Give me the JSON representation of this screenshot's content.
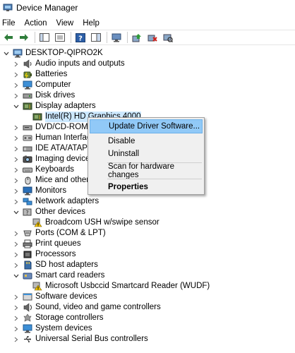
{
  "window": {
    "title": "Device Manager"
  },
  "menu": {
    "items": [
      "File",
      "Action",
      "View",
      "Help"
    ]
  },
  "toolbar": {
    "buttons": [
      "back-arrow-icon",
      "forward-arrow-icon",
      "show-hide-console-tree-icon",
      "properties-icon",
      "help-icon",
      "action-pane-icon",
      "device-monitor-icon",
      "update-driver-icon",
      "uninstall-icon",
      "scan-hardware-icon"
    ]
  },
  "tree": {
    "root": "DESKTOP-QIPRO2K",
    "categories": [
      {
        "label": "Audio inputs and outputs",
        "icon": "speaker-icon"
      },
      {
        "label": "Batteries",
        "icon": "battery-icon"
      },
      {
        "label": "Computer",
        "icon": "computer-icon"
      },
      {
        "label": "Disk drives",
        "icon": "disk-drive-icon"
      },
      {
        "label": "Display adapters",
        "icon": "display-adapter-icon",
        "expanded": true,
        "children": [
          {
            "label": "Intel(R) HD Graphics 4000",
            "selected": true
          }
        ]
      },
      {
        "label": "DVD/CD-ROM dr",
        "icon": "dvd-icon"
      },
      {
        "label": "Human Interface",
        "icon": "hid-icon"
      },
      {
        "label": "IDE ATA/ATAPI co",
        "icon": "ide-icon"
      },
      {
        "label": "Imaging devices",
        "icon": "camera-icon"
      },
      {
        "label": "Keyboards",
        "icon": "keyboard-icon"
      },
      {
        "label": "Mice and other p",
        "icon": "mouse-icon"
      },
      {
        "label": "Monitors",
        "icon": "monitor-icon"
      },
      {
        "label": "Network adapters",
        "icon": "network-icon"
      },
      {
        "label": "Other devices",
        "icon": "other-devices-icon",
        "expanded": true,
        "children": [
          {
            "label": "Broadcom USH w/swipe sensor",
            "warning": true
          }
        ]
      },
      {
        "label": "Ports (COM & LPT)",
        "icon": "port-icon"
      },
      {
        "label": "Print queues",
        "icon": "printer-icon"
      },
      {
        "label": "Processors",
        "icon": "processor-icon"
      },
      {
        "label": "SD host adapters",
        "icon": "sd-icon"
      },
      {
        "label": "Smart card readers",
        "icon": "smart-card-icon",
        "expanded": true,
        "children": [
          {
            "label": "Microsoft Usbccid Smartcard Reader (WUDF)",
            "warning": true
          }
        ]
      },
      {
        "label": "Software devices",
        "icon": "software-icon"
      },
      {
        "label": "Sound, video and game controllers",
        "icon": "sound-icon"
      },
      {
        "label": "Storage controllers",
        "icon": "storage-icon"
      },
      {
        "label": "System devices",
        "icon": "system-icon"
      },
      {
        "label": "Universal Serial Bus controllers",
        "icon": "usb-icon"
      }
    ]
  },
  "context_menu": {
    "items": [
      "Update Driver Software...",
      "Disable",
      "Uninstall",
      "Scan for hardware changes",
      "Properties"
    ],
    "highlighted": "Update Driver Software..."
  },
  "colors": {
    "selection": "#cce8ff",
    "menu_highlight": "#91c9f7",
    "warning": "#f2c500"
  }
}
